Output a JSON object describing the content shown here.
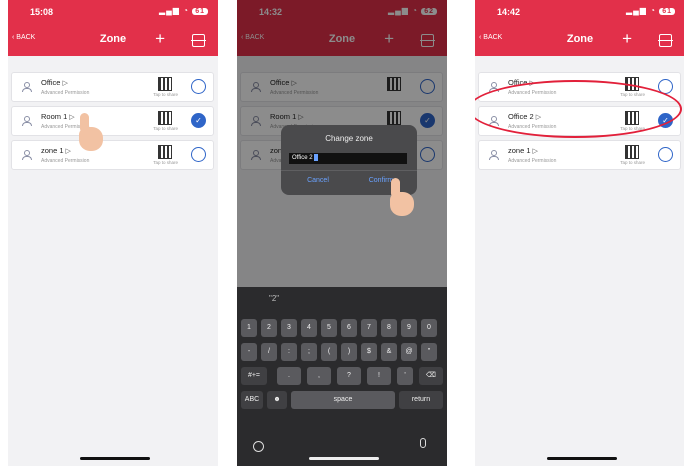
{
  "screens": [
    {
      "time": "15:08",
      "battery": "61",
      "nav": {
        "back": "BACK",
        "title": "Zone"
      },
      "zones": [
        {
          "name": "Office",
          "permission": "Advanced Permission",
          "share": "Tap to share",
          "selected": false
        },
        {
          "name": "Room 1",
          "permission": "Advanced Permission",
          "share": "Tap to share",
          "selected": true
        },
        {
          "name": "zone 1",
          "permission": "Advanced Permission",
          "share": "Tap to share",
          "selected": false
        }
      ]
    },
    {
      "time": "14:32",
      "battery": "62",
      "nav": {
        "back": "BACK",
        "title": "Zone"
      },
      "zones": [
        {
          "name": "Office",
          "permission": "Advanced Permission",
          "selected": false
        },
        {
          "name": "Room 1",
          "permission": "Advanced Permission",
          "selected": true
        },
        {
          "name": "zone 1",
          "permission": "Advanced Permission",
          "selected": false
        }
      ],
      "dialog": {
        "title": "Change zone",
        "input_value": "Office 2",
        "cancel": "Cancel",
        "confirm": "Confirm"
      },
      "keyboard": {
        "suggestion": "\"2\"",
        "row1": [
          "1",
          "2",
          "3",
          "4",
          "5",
          "6",
          "7",
          "8",
          "9",
          "0"
        ],
        "row2": [
          "-",
          "/",
          ":",
          ";",
          "(",
          ")",
          "$",
          "&",
          "@",
          "\""
        ],
        "row3": [
          "#+=",
          ".",
          ",",
          "?",
          "!",
          "'",
          "⌫"
        ],
        "row4": [
          "ABC",
          "☻",
          "space",
          "return"
        ]
      }
    },
    {
      "time": "14:42",
      "battery": "61",
      "nav": {
        "back": "BACK",
        "title": "Zone"
      },
      "zones": [
        {
          "name": "Office",
          "permission": "Advanced Permission",
          "share": "Tap to share",
          "selected": false
        },
        {
          "name": "Office 2",
          "permission": "Advanced Permission",
          "share": "Tap to share",
          "selected": true
        },
        {
          "name": "zone 1",
          "permission": "Advanced Permission",
          "share": "Tap to share",
          "selected": false
        }
      ]
    }
  ],
  "colors": {
    "header": "#e2304a",
    "accent": "#2f65c8",
    "highlight_ring": "#e2203a"
  }
}
